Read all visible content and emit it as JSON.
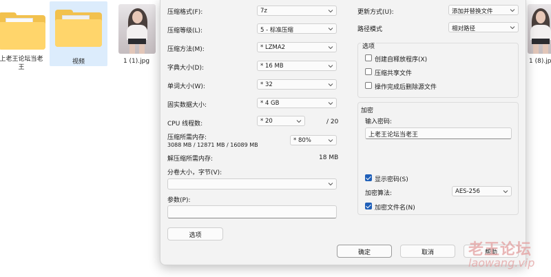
{
  "explorer": {
    "files": [
      {
        "name": "上老王论坛当老王",
        "type": "folder"
      },
      {
        "name": "视频",
        "type": "folder"
      },
      {
        "name": "1 (1).jpg",
        "type": "image"
      },
      {
        "name": "1 (8).jpg",
        "type": "image"
      }
    ]
  },
  "dialog": {
    "left": {
      "format_label": "压缩格式(F):",
      "format_value": "7z",
      "level_label": "压缩等级(L):",
      "level_value": "5 - 标准压缩",
      "method_label": "压缩方法(M):",
      "method_value": "* LZMA2",
      "dict_label": "字典大小(D):",
      "dict_value": "* 16 MB",
      "word_label": "单词大小(W):",
      "word_value": "* 32",
      "solid_label": "固实数据大小:",
      "solid_value": "* 4 GB",
      "cpu_label": "CPU 线程数:",
      "cpu_value": "* 20",
      "cpu_total": "/ 20",
      "mem_label": "压缩所需内存:",
      "mem_detail": "3088 MB / 12871 MB / 16089 MB",
      "mem_value": "* 80%",
      "decomp_label": "解压缩所需内存:",
      "decomp_value": "18 MB",
      "split_label": "分卷大小，字节(V):",
      "split_value": "",
      "params_label": "参数(P):",
      "params_value": "",
      "options_button": "选项"
    },
    "right": {
      "update_label": "更新方式(U):",
      "update_value": "添加并替换文件",
      "path_label": "路径模式",
      "path_value": "相对路径",
      "options_title": "选项",
      "opt_sfx": "创建自释放程序(X)",
      "opt_shared": "压缩共享文件",
      "opt_delete": "操作完成后删除源文件",
      "enc_title": "加密",
      "pwd_label": "输入密码:",
      "pwd_value": "上老王论坛当老王",
      "show_pwd": "显示密码(S)",
      "enc_method_label": "加密算法:",
      "enc_method_value": "AES-256",
      "enc_names": "加密文件名(N)"
    },
    "buttons": {
      "ok": "确定",
      "cancel": "取消",
      "help": "帮助"
    }
  },
  "watermark": {
    "line1": "老王论坛",
    "line2": "laowang.vip"
  },
  "colors": {
    "accent": "#1f5fb8",
    "selection": "#dcecfc",
    "folder": "#ffd56b"
  }
}
